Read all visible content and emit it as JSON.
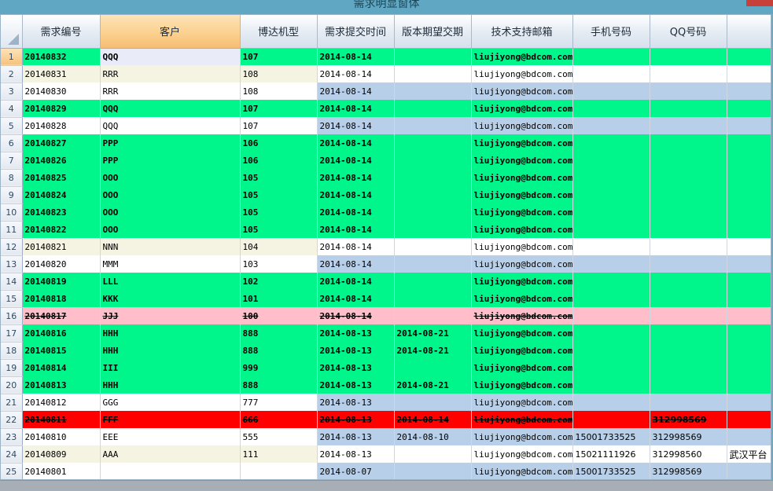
{
  "window": {
    "title": "需求明显窗体"
  },
  "columns": [
    "需求编号",
    "客户",
    "博达机型",
    "需求提交时间",
    "版本期望交期",
    "技术支持邮箱",
    "手机号码",
    "QQ号码",
    ""
  ],
  "rows": [
    {
      "n": "1",
      "style": "green",
      "sel": true,
      "cells": [
        "20140832",
        "QQQ",
        "107",
        "2014-08-14",
        "",
        "liujiyong@bdcom.com",
        "",
        "",
        ""
      ]
    },
    {
      "n": "2",
      "style": "plain",
      "cells": [
        "20140831",
        "RRR",
        "108",
        "2014-08-14",
        "",
        "liujiyong@bdcom.com",
        "",
        "",
        ""
      ]
    },
    {
      "n": "3",
      "style": "blue",
      "cells": [
        "20140830",
        "RRR",
        "108",
        "2014-08-14",
        "",
        "liujiyong@bdcom.com",
        "",
        "",
        ""
      ]
    },
    {
      "n": "4",
      "style": "green",
      "cells": [
        "20140829",
        "QQQ",
        "107",
        "2014-08-14",
        "",
        "liujiyong@bdcom.com",
        "",
        "",
        ""
      ]
    },
    {
      "n": "5",
      "style": "blue",
      "cells": [
        "20140828",
        "QQQ",
        "107",
        "2014-08-14",
        "",
        "liujiyong@bdcom.com",
        "",
        "",
        ""
      ]
    },
    {
      "n": "6",
      "style": "green",
      "cells": [
        "20140827",
        "PPP",
        "106",
        "2014-08-14",
        "",
        "liujiyong@bdcom.com",
        "",
        "",
        ""
      ]
    },
    {
      "n": "7",
      "style": "green",
      "cells": [
        "20140826",
        "PPP",
        "106",
        "2014-08-14",
        "",
        "liujiyong@bdcom.com",
        "",
        "",
        ""
      ]
    },
    {
      "n": "8",
      "style": "green",
      "cells": [
        "20140825",
        "OOO",
        "105",
        "2014-08-14",
        "",
        "liujiyong@bdcom.com",
        "",
        "",
        ""
      ]
    },
    {
      "n": "9",
      "style": "green",
      "cells": [
        "20140824",
        "OOO",
        "105",
        "2014-08-14",
        "",
        "liujiyong@bdcom.com",
        "",
        "",
        ""
      ]
    },
    {
      "n": "10",
      "style": "green",
      "cells": [
        "20140823",
        "OOO",
        "105",
        "2014-08-14",
        "",
        "liujiyong@bdcom.com",
        "",
        "",
        ""
      ]
    },
    {
      "n": "11",
      "style": "green",
      "cells": [
        "20140822",
        "OOO",
        "105",
        "2014-08-14",
        "",
        "liujiyong@bdcom.com",
        "",
        "",
        ""
      ]
    },
    {
      "n": "12",
      "style": "plain",
      "cells": [
        "20140821",
        "NNN",
        "104",
        "2014-08-14",
        "",
        "liujiyong@bdcom.com",
        "",
        "",
        ""
      ]
    },
    {
      "n": "13",
      "style": "blue",
      "cells": [
        "20140820",
        "MMM",
        "103",
        "2014-08-14",
        "",
        "liujiyong@bdcom.com",
        "",
        "",
        ""
      ]
    },
    {
      "n": "14",
      "style": "green",
      "cells": [
        "20140819",
        "LLL",
        "102",
        "2014-08-14",
        "",
        "liujiyong@bdcom.com",
        "",
        "",
        ""
      ]
    },
    {
      "n": "15",
      "style": "green",
      "cells": [
        "20140818",
        "KKK",
        "101",
        "2014-08-14",
        "",
        "liujiyong@bdcom.com",
        "",
        "",
        ""
      ]
    },
    {
      "n": "16",
      "style": "strike",
      "cells": [
        "20140817",
        "JJJ",
        "100",
        "2014-08-14",
        "",
        "liujiyong@bdcom.com",
        "",
        "",
        ""
      ]
    },
    {
      "n": "17",
      "style": "green",
      "cells": [
        "20140816",
        "HHH",
        "888",
        "2014-08-13",
        "2014-08-21",
        "liujiyong@bdcom.com",
        "",
        "",
        ""
      ]
    },
    {
      "n": "18",
      "style": "green",
      "cells": [
        "20140815",
        "HHH",
        "888",
        "2014-08-13",
        "2014-08-21",
        "liujiyong@bdcom.com",
        "",
        "",
        ""
      ]
    },
    {
      "n": "19",
      "style": "green",
      "cells": [
        "20140814",
        "III",
        "999",
        "2014-08-13",
        "",
        "liujiyong@bdcom.com",
        "",
        "",
        ""
      ]
    },
    {
      "n": "20",
      "style": "green",
      "cells": [
        "20140813",
        "HHH",
        "888",
        "2014-08-13",
        "2014-08-21",
        "liujiyong@bdcom.com",
        "",
        "",
        ""
      ]
    },
    {
      "n": "21",
      "style": "blue",
      "cells": [
        "20140812",
        "GGG",
        "777",
        "2014-08-13",
        "",
        "liujiyong@bdcom.com",
        "",
        "",
        ""
      ]
    },
    {
      "n": "22",
      "style": "red",
      "cells": [
        "20140811",
        "FFF",
        "666",
        "2014-08-13",
        "2014-08-14",
        "liujiyong@bdcom.com",
        "",
        "312998569",
        ""
      ]
    },
    {
      "n": "23",
      "style": "blue",
      "cells": [
        "20140810",
        "EEE",
        "555",
        "2014-08-13",
        "2014-08-10",
        "liujiyong@bdcom.com",
        "15001733525",
        "312998569",
        ""
      ]
    },
    {
      "n": "24",
      "style": "plain",
      "cells": [
        "20140809",
        "AAA",
        "111",
        "2014-08-13",
        "",
        "liujiyong@bdcom.com",
        "15021111926",
        "312998560",
        "武汉平台"
      ]
    },
    {
      "n": "25",
      "style": "blue",
      "cells": [
        "20140801",
        "",
        "",
        "2014-08-07",
        "",
        "liujiyong@bdcom.com",
        "15001733525",
        "312998569",
        ""
      ]
    }
  ],
  "colors": {
    "ok": "#00f58b",
    "deleted": "#ffbec9",
    "alert": "#ff0000",
    "alt": "#b8cfe9"
  }
}
